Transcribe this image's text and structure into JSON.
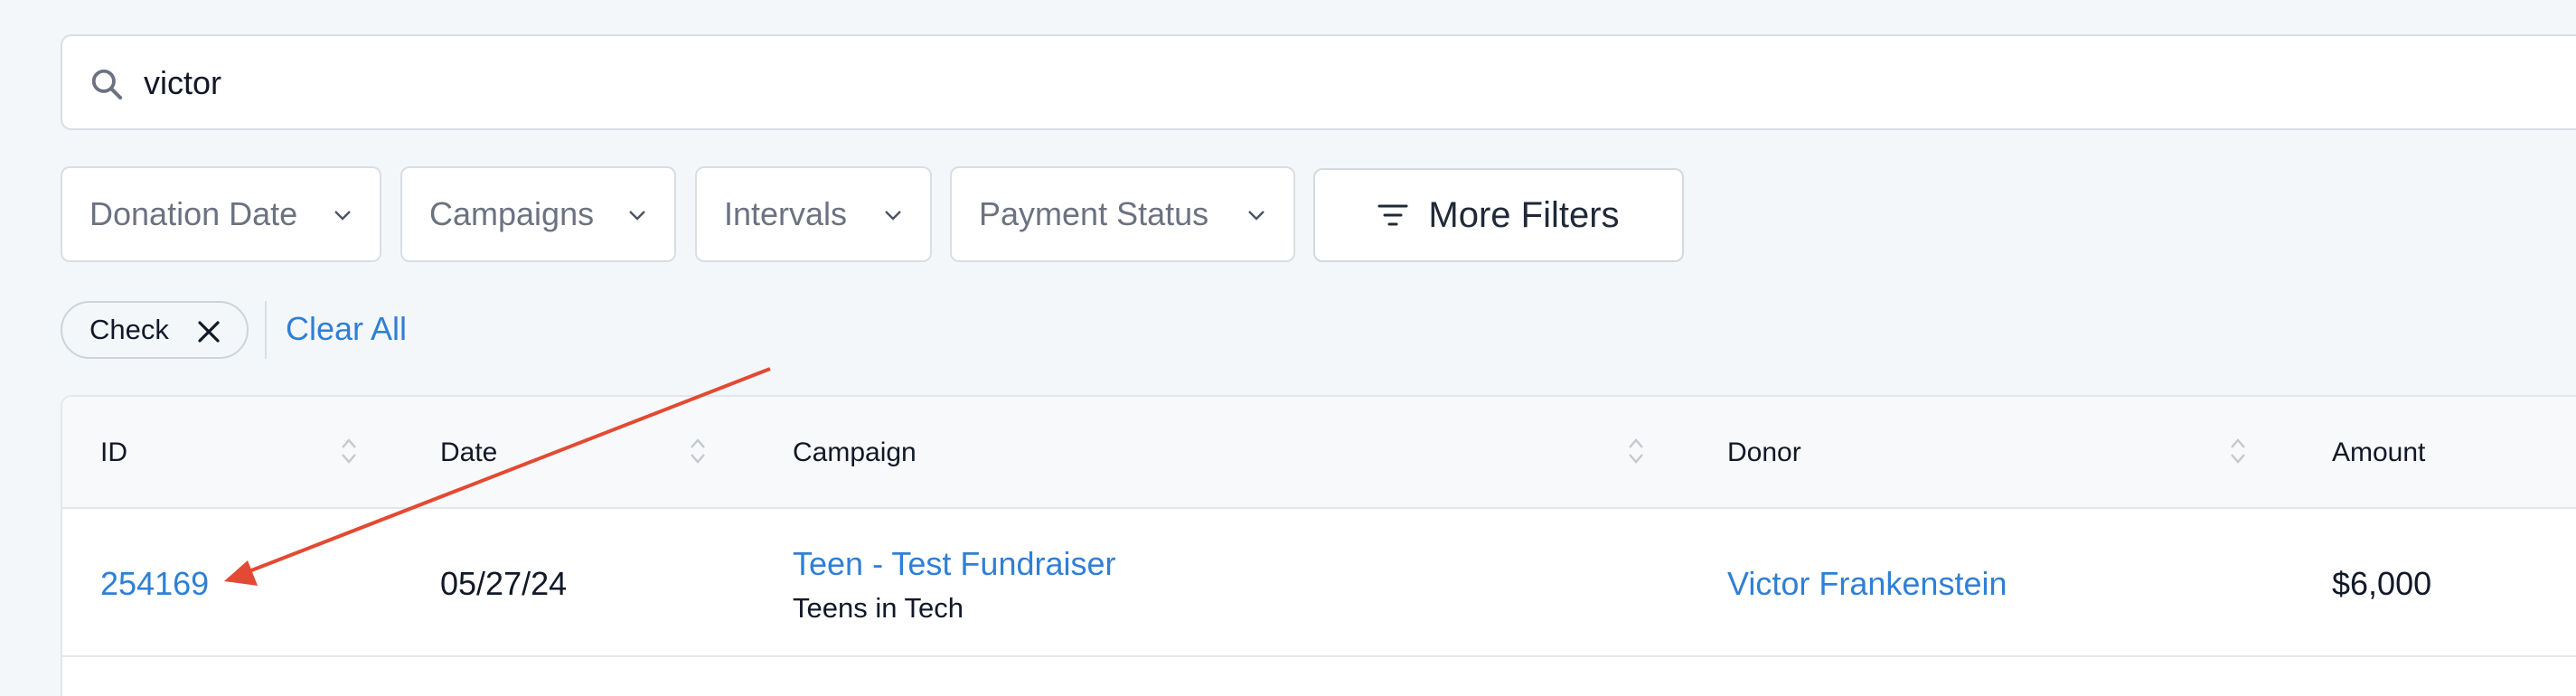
{
  "search": {
    "value": "victor",
    "icon": "search-icon"
  },
  "filters": [
    {
      "label": "Donation Date"
    },
    {
      "label": "Campaigns"
    },
    {
      "label": "Intervals"
    },
    {
      "label": "Payment Status"
    }
  ],
  "more_filters": {
    "label": "More Filters",
    "icon": "filter-lines-icon"
  },
  "active_filter": {
    "label": "Check",
    "icon": "close-icon"
  },
  "clear_all": "Clear All",
  "table": {
    "columns": [
      "ID",
      "Date",
      "Campaign",
      "Donor",
      "Amount"
    ],
    "rows": [
      {
        "id": "254169",
        "date": "05/27/24",
        "campaign": "Teen - Test Fundraiser",
        "campaign_org": "Teens in Tech",
        "donor": "Victor Frankenstein",
        "amount": "$6,000"
      }
    ]
  },
  "colors": {
    "link": "#2f7fd4",
    "annotation_arrow": "#e24a33",
    "background": "#f4f7f9"
  }
}
